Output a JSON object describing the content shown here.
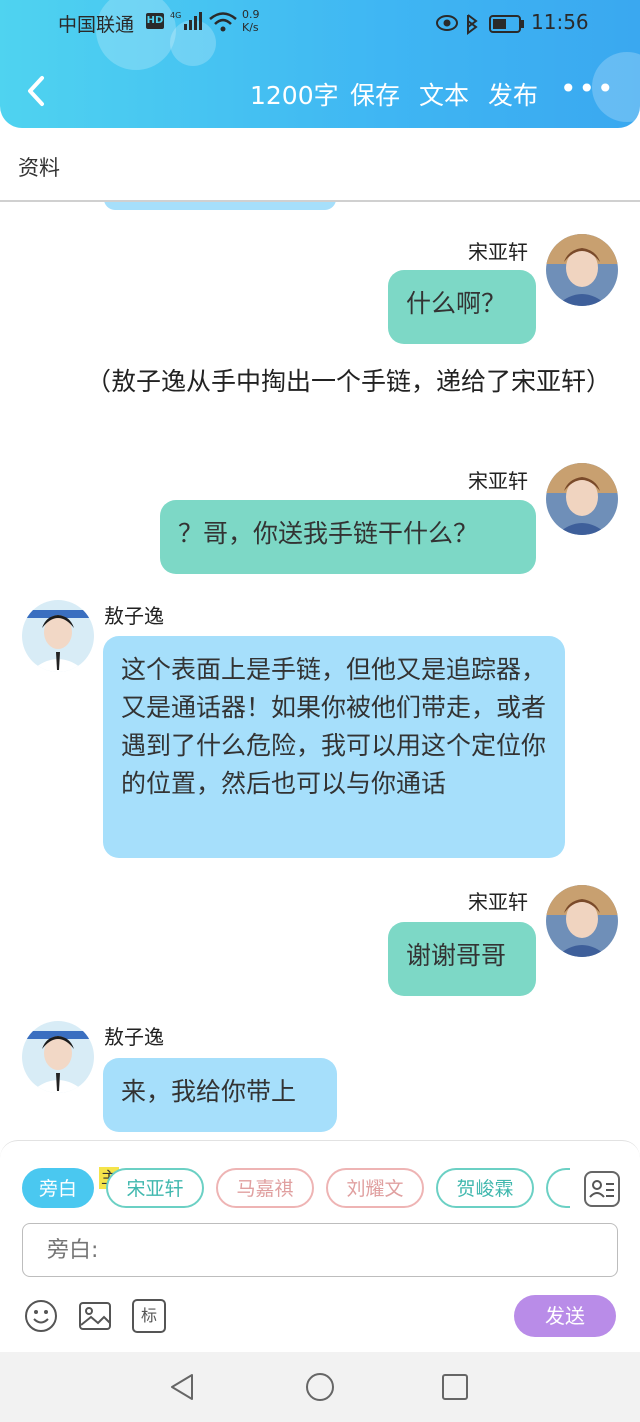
{
  "status_bar": {
    "carrier": "中国联通",
    "hd": "HD",
    "network": "4G",
    "speed_value": "0.9",
    "speed_unit": "K/s",
    "time": "11:56"
  },
  "header": {
    "word_count": "1200字",
    "save": "保存",
    "text": "文本",
    "publish": "发布",
    "more": "•••"
  },
  "info": {
    "label": "资料"
  },
  "messages": [
    {
      "type": "right",
      "name": "宋亚轩",
      "text": "什么啊？"
    },
    {
      "type": "narration",
      "text": "（敖子逸从手中掏出一个手链，递给了宋亚轩）"
    },
    {
      "type": "right",
      "name": "宋亚轩",
      "text": "？哥，你送我手链干什么？"
    },
    {
      "type": "left",
      "name": "敖子逸",
      "text": "这个表面上是手链，但他又是追踪器，又是通话器！如果你被他们带走，或者遇到了什么危险，我可以用这个定位你的位置，然后也可以与你通话"
    },
    {
      "type": "right",
      "name": "宋亚轩",
      "text": "谢谢哥哥"
    },
    {
      "type": "left",
      "name": "敖子逸",
      "text": "来，我给你带上"
    }
  ],
  "characters": {
    "narrator": "旁白",
    "main_tag": "主",
    "list": [
      "宋亚轩",
      "马嘉祺",
      "刘耀文",
      "贺峻霖"
    ]
  },
  "input": {
    "placeholder": "旁白:"
  },
  "toolbar": {
    "mark_label": "标",
    "send": "发送"
  },
  "colors": {
    "header": "#3fb6f3",
    "right_bubble": "#7dd8c6",
    "left_bubble": "#a6dffb",
    "send_button": "#b98ce8"
  }
}
